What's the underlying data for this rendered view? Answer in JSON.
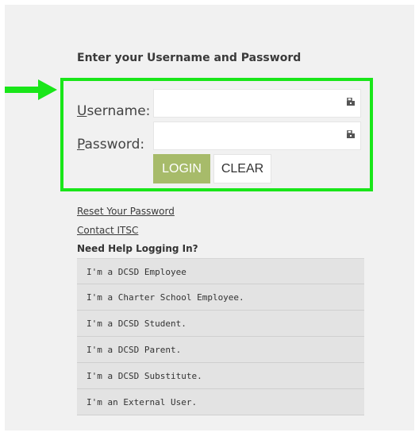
{
  "form": {
    "heading": "Enter your Username and Password",
    "username": {
      "label_accel": "U",
      "label_rest": "sername:",
      "value": ""
    },
    "password": {
      "label_accel": "P",
      "label_rest": "assword:",
      "value": ""
    },
    "login_label": "LOGIN",
    "clear_label": "CLEAR"
  },
  "links": {
    "reset_password": "Reset Your Password",
    "contact": "Contact ITSC"
  },
  "help": {
    "title": "Need Help Logging In?",
    "items": [
      "I'm a DCSD Employee",
      "I'm a Charter School Employee.",
      "I'm a DCSD Student.",
      "I'm a DCSD Parent.",
      "I'm a DCSD Substitute.",
      "I'm an External User."
    ]
  },
  "colors": {
    "highlight_green": "#19e619",
    "login_button": "#a7bb6a",
    "panel_background": "#f1f1f1"
  },
  "icons": {
    "pointer": "arrow-right-icon",
    "field_helper": "key-icon"
  }
}
